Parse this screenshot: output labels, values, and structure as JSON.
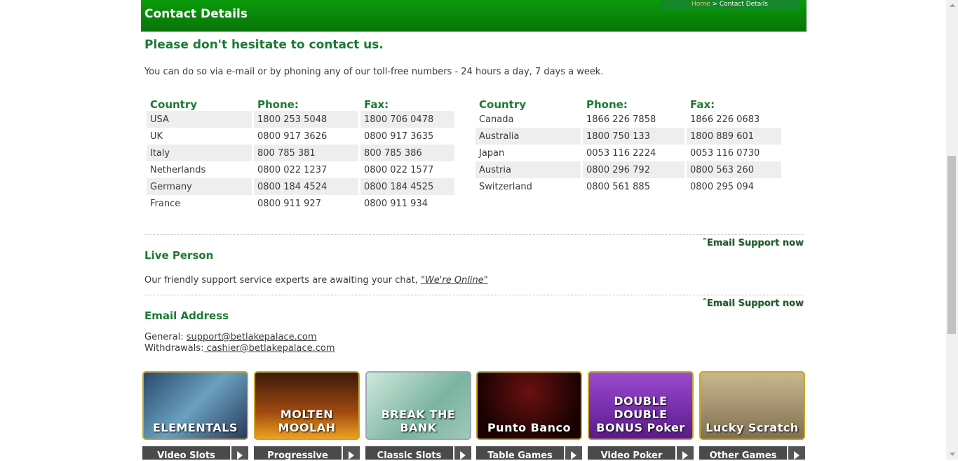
{
  "header": {
    "title": "Contact Details"
  },
  "breadcrumb": {
    "home": "Home",
    "separator": " > ",
    "current": "Contact Details"
  },
  "headline": "Please don't hesitate to contact us.",
  "intro": "You can do so via e-mail or by phoning any of our toll-free numbers - 24 hours a day, 7 days a week.",
  "phone_table": {
    "headers": [
      "Country",
      "Phone:",
      "Fax:"
    ],
    "left": [
      [
        "USA",
        "1800 253 5048",
        "1800 706 0478"
      ],
      [
        "UK",
        "0800 917 3626",
        "0800 917 3635"
      ],
      [
        "Italy",
        "800 785 381",
        "800 785 386"
      ],
      [
        "Netherlands",
        "0800 022 1237",
        "0800 022 1577"
      ],
      [
        "Germany",
        "0800 184 4524",
        "0800 184 4525"
      ],
      [
        "France",
        "0800 911 927",
        "0800 911 934"
      ]
    ],
    "right": [
      [
        "Canada",
        "1866 226 7858",
        "1866 226 0683"
      ],
      [
        "Australia",
        "1800 750 133",
        "1800 889 601"
      ],
      [
        "Japan",
        "0053 116 2224",
        "0053 116 0730"
      ],
      [
        "Austria",
        "0800 296 792",
        "0800 563 260"
      ],
      [
        "Switzerland",
        "0800 561 885",
        "0800 295 094"
      ]
    ]
  },
  "email_support_label": "Email Support now",
  "live_person": {
    "title": "Live Person",
    "text": "Our friendly support service experts are awaiting your chat, ",
    "link": "\"We're Online\""
  },
  "email_address": {
    "title": "Email Address",
    "general_label": "General: ",
    "general_email": "support@betlakepalace.com ",
    "withdrawals_label": "Withdrawals:",
    "withdrawals_email": " cashier@betlakepalace.com"
  },
  "games": [
    {
      "title": "ELEMENTALS",
      "bg": "#3a5a7a"
    },
    {
      "title": "MOLTEN MOOLAH",
      "bg": "#5a2a10"
    },
    {
      "title": "BREAK THE BANK",
      "bg": "#9ac4b4"
    },
    {
      "title": "Punto Banco",
      "bg": "#3a0808"
    },
    {
      "title": "DOUBLE DOUBLE BONUS Poker",
      "bg": "#7a2aa4"
    },
    {
      "title": "Lucky Scratch",
      "bg": "#a09070"
    }
  ],
  "categories": [
    "Video Slots",
    "Progressive",
    "Classic Slots",
    "Table Games",
    "Video Poker",
    "Other Games"
  ]
}
